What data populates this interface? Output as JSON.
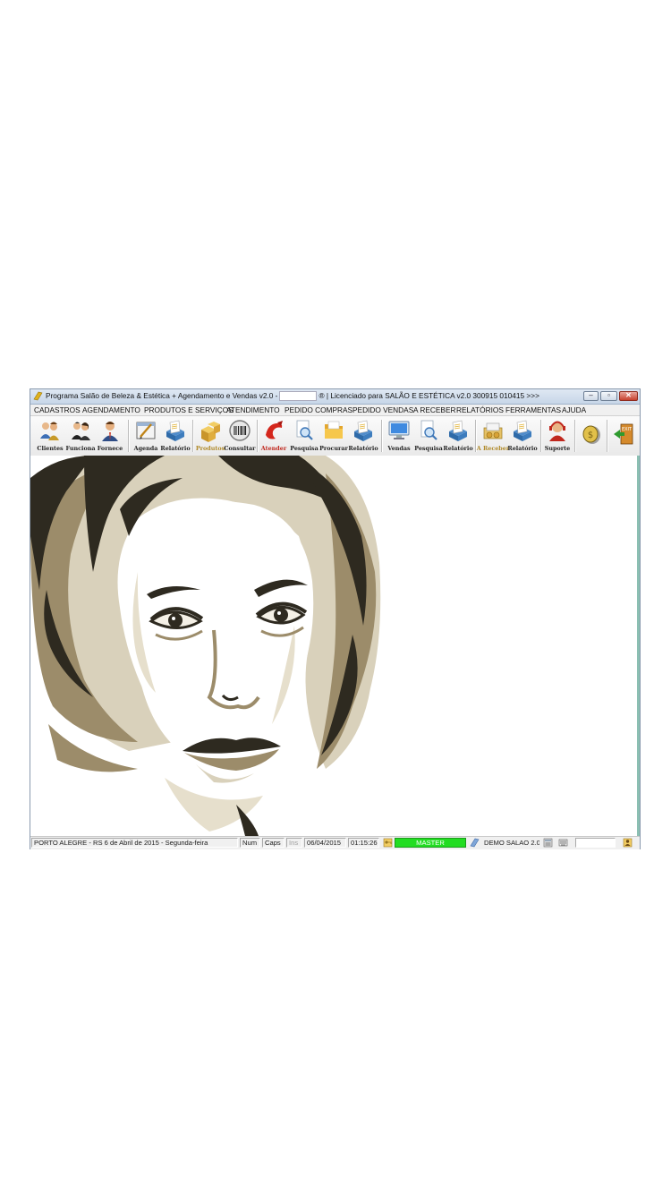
{
  "window": {
    "title_prefix": "Programa Salão de Beleza & Estética + Agendamento e Vendas v2.0 -",
    "title_suffix": "® | Licenciado para  SALÃO E ESTÉTICA v2.0 300915 010415 >>>",
    "minimize": "–",
    "restore": "▫",
    "close": "✕"
  },
  "menu": [
    "CADASTROS",
    "AGENDAMENTO",
    "PRODUTOS E SERVIÇOS",
    "ATENDIMENTO",
    "PEDIDO COMPRAS",
    "PEDIDO VENDAS",
    "A RECEBER",
    "RELATÓRIOS",
    "FERRAMENTAS",
    "AJUDA"
  ],
  "toolbar": [
    {
      "label": "Clientes",
      "icon": "clients-icon",
      "color": "#222222"
    },
    {
      "label": "Funciona",
      "icon": "employees-icon",
      "color": "#222222"
    },
    {
      "label": "Fornece",
      "icon": "suppliers-icon",
      "color": "#222222"
    },
    {
      "label": "Agenda",
      "icon": "schedule-icon",
      "color": "#222222"
    },
    {
      "label": "Relatório",
      "icon": "report-icon",
      "color": "#222222"
    },
    {
      "label": "Produtos",
      "icon": "products-icon",
      "color": "#b08a2a"
    },
    {
      "label": "Consultar",
      "icon": "barcode-icon",
      "color": "#222222"
    },
    {
      "label": "Atender",
      "icon": "attend-icon",
      "color": "#c0281e"
    },
    {
      "label": "Pesquisa",
      "icon": "search-doc-icon",
      "color": "#222222"
    },
    {
      "label": "Procurar",
      "icon": "folder-icon",
      "color": "#222222"
    },
    {
      "label": "Relatório",
      "icon": "report-icon",
      "color": "#222222"
    },
    {
      "label": "Vendas",
      "icon": "monitor-icon",
      "color": "#222222"
    },
    {
      "label": "Pesquisa",
      "icon": "search-doc-icon",
      "color": "#222222"
    },
    {
      "label": "Relatório",
      "icon": "report-icon",
      "color": "#222222"
    },
    {
      "label": "A Receber",
      "icon": "receivables-icon",
      "color": "#b08a2a"
    },
    {
      "label": "Relatório",
      "icon": "report-icon",
      "color": "#222222"
    },
    {
      "label": "Suporte",
      "icon": "support-icon",
      "color": "#222222"
    },
    {
      "label": "",
      "icon": "coin-icon",
      "color": "#222222"
    },
    {
      "label": "",
      "icon": "exit-icon",
      "color": "#222222"
    }
  ],
  "status": {
    "location": "PORTO ALEGRE - RS  6 de Abril de 2015 - Segunda-feira",
    "num": "Num",
    "caps": "Caps",
    "ins": "Ins",
    "date": "06/04/2015",
    "time": "01:15:26",
    "user": "MASTER",
    "company": "DEMO SALAO 2.0"
  },
  "colors": {
    "status_master": "#22dd22",
    "art_dark": "#2e2a20",
    "art_mid": "#9c8c6a",
    "art_light": "#d9d1bb"
  }
}
